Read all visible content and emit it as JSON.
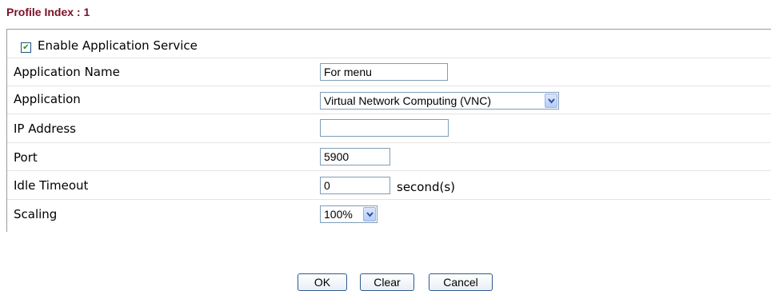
{
  "profile": {
    "title": "Profile Index : 1"
  },
  "form": {
    "enable": {
      "label": "Enable Application Service",
      "checked": true
    },
    "app_name": {
      "label": "Application Name",
      "value": "For menu"
    },
    "application": {
      "label": "Application",
      "value": "Virtual Network Computing (VNC)"
    },
    "ip_address": {
      "label": "IP Address",
      "value": ""
    },
    "port": {
      "label": "Port",
      "value": "5900"
    },
    "idle_timeout": {
      "label": "Idle Timeout",
      "value": "0",
      "unit": "second(s)"
    },
    "scaling": {
      "label": "Scaling",
      "value": "100%"
    }
  },
  "buttons": {
    "ok": "OK",
    "clear": "Clear",
    "cancel": "Cancel"
  },
  "colors": {
    "title": "#7b1027",
    "field_border": "#7f9db9",
    "button_border": "#2f5a8c",
    "check_mark": "#1f8f1f"
  },
  "icons": {
    "dropdown": "chevron-down-icon",
    "check": "checkmark-icon"
  }
}
